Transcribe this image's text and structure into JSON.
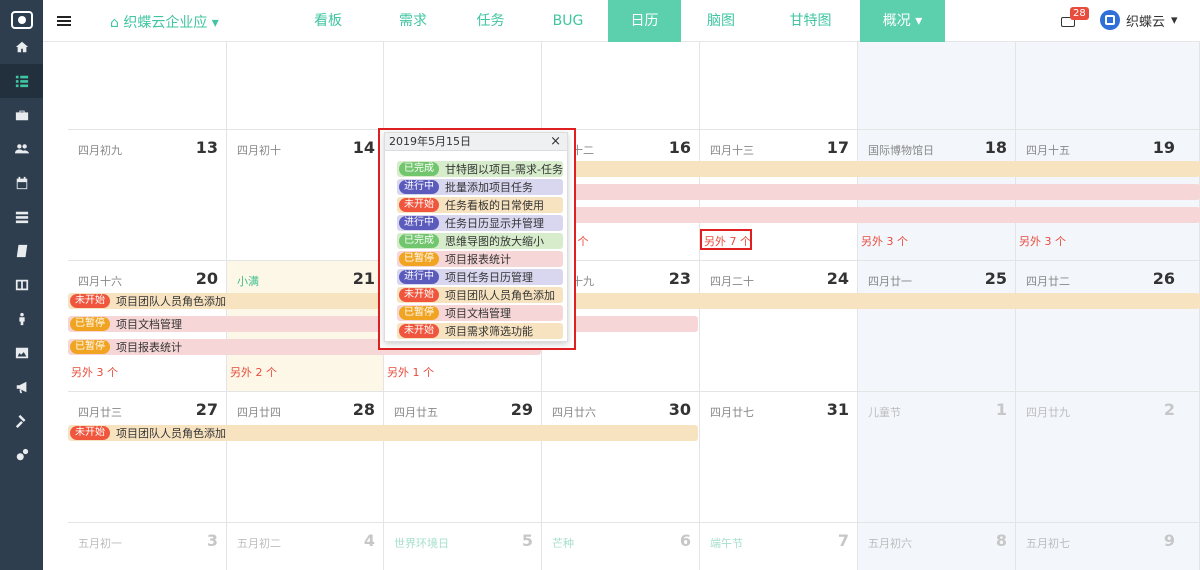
{
  "sidebar": {
    "icons": [
      "home-icon",
      "list-icon",
      "briefcase-icon",
      "users-icon",
      "calendar-icon",
      "server-icon",
      "book-icon",
      "columns-icon",
      "person-icon",
      "image-icon",
      "bullhorn-icon",
      "gavel-icon",
      "cogs-icon"
    ],
    "active_index": 1
  },
  "topbar": {
    "project_name": "织蝶云企业应",
    "nav": [
      {
        "label": "看板",
        "active": false
      },
      {
        "label": "需求",
        "active": false
      },
      {
        "label": "任务",
        "active": false
      },
      {
        "label": "BUG",
        "active": false
      },
      {
        "label": "日历",
        "active": true
      },
      {
        "label": "脑图",
        "active": false
      },
      {
        "label": "甘特图",
        "active": false
      },
      {
        "label": "概况",
        "active": true,
        "dropdown": true
      }
    ],
    "mail_count": "28",
    "user_name": "织蝶云"
  },
  "calendar": {
    "weeks": [
      {
        "days": [
          {
            "lunar": "",
            "num": ""
          },
          {
            "lunar": "",
            "num": ""
          },
          {
            "lunar": "",
            "num": ""
          },
          {
            "lunar": "",
            "num": ""
          },
          {
            "lunar": "",
            "num": ""
          },
          {
            "lunar": "",
            "num": ""
          },
          {
            "lunar": "",
            "num": ""
          }
        ]
      },
      {
        "days": [
          {
            "lunar": "四月初九",
            "num": "13"
          },
          {
            "lunar": "四月初十",
            "num": "14"
          },
          {
            "lunar": "",
            "num": ""
          },
          {
            "lunar": "十二",
            "num": "16"
          },
          {
            "lunar": "四月十三",
            "num": "17"
          },
          {
            "lunar": "国际博物馆日",
            "num": "18"
          },
          {
            "lunar": "四月十五",
            "num": "19"
          }
        ],
        "more": [
          "",
          "",
          "",
          "7 个",
          "另外 7 个",
          "另外 3 个",
          "另外 3 个"
        ]
      },
      {
        "days": [
          {
            "lunar": "四月十六",
            "num": "20"
          },
          {
            "lunar": "小满",
            "num": "21"
          },
          {
            "lunar": "",
            "num": ""
          },
          {
            "lunar": "十九",
            "num": "23"
          },
          {
            "lunar": "四月二十",
            "num": "24"
          },
          {
            "lunar": "四月廿一",
            "num": "25"
          },
          {
            "lunar": "四月廿二",
            "num": "26"
          }
        ],
        "more": [
          "另外 3 个",
          "另外 2 个",
          "另外 1 个",
          "",
          "",
          "",
          ""
        ]
      },
      {
        "days": [
          {
            "lunar": "四月廿三",
            "num": "27"
          },
          {
            "lunar": "四月廿四",
            "num": "28"
          },
          {
            "lunar": "四月廿五",
            "num": "29"
          },
          {
            "lunar": "四月廿六",
            "num": "30"
          },
          {
            "lunar": "四月廿七",
            "num": "31"
          },
          {
            "lunar": "儿童节",
            "num": "1"
          },
          {
            "lunar": "四月廿九",
            "num": "2"
          }
        ]
      },
      {
        "days": [
          {
            "lunar": "五月初一",
            "num": "3"
          },
          {
            "lunar": "五月初二",
            "num": "4"
          },
          {
            "lunar": "世界环境日",
            "num": "5"
          },
          {
            "lunar": "芒种",
            "num": "6"
          },
          {
            "lunar": "端午节",
            "num": "7"
          },
          {
            "lunar": "五月初六",
            "num": "8"
          },
          {
            "lunar": "五月初七",
            "num": "9"
          }
        ]
      }
    ],
    "events": {
      "w3_e1": {
        "status": "未开始",
        "title": "项目团队人员角色添加"
      },
      "w3_e2": {
        "status": "已暂停",
        "title": "项目文档管理"
      },
      "w3_e3": {
        "status": "已暂停",
        "title": "项目报表统计"
      },
      "w4_e1": {
        "status": "未开始",
        "title": "项目团队人员角色添加"
      }
    }
  },
  "popup": {
    "date": "2019年5月15日",
    "close": "×",
    "items": [
      {
        "status": "已完成",
        "title": "甘特图以项目-需求-任务"
      },
      {
        "status": "进行中",
        "title": "批量添加项目任务"
      },
      {
        "status": "未开始",
        "title": "任务看板的日常使用"
      },
      {
        "status": "进行中",
        "title": "任务日历显示并管理"
      },
      {
        "status": "已完成",
        "title": "思维导图的放大缩小"
      },
      {
        "status": "已暂停",
        "title": "项目报表统计"
      },
      {
        "status": "进行中",
        "title": "项目任务日历管理"
      },
      {
        "status": "未开始",
        "title": "项目团队人员角色添加"
      },
      {
        "status": "已暂停",
        "title": "项目文档管理"
      },
      {
        "status": "未开始",
        "title": "项目需求筛选功能"
      }
    ]
  },
  "colors": {
    "accent": "#41c5a1",
    "sidebar": "#2f3e4e",
    "todo": "#f0563d",
    "pause": "#f0a422",
    "done": "#71c66d",
    "doing": "#5b5bbd",
    "highlight": "#e02020"
  }
}
